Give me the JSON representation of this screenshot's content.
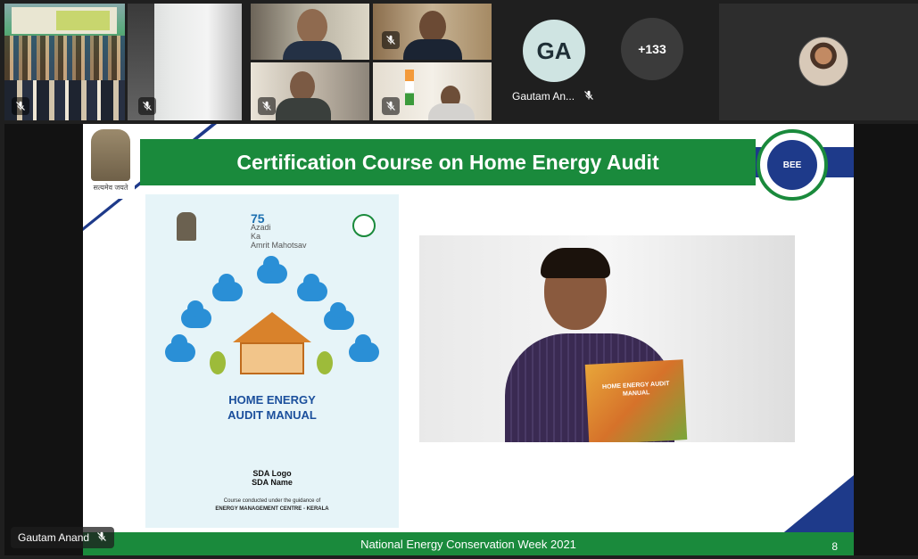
{
  "participants": {
    "named": {
      "initials": "GA",
      "name": "Gautam An..."
    },
    "overflow_count": "+133"
  },
  "slide": {
    "title": "Certification Course on Home Energy Audit",
    "emblem_motto": "सत्यमेव जयते",
    "footer": "National Energy Conservation Week 2021",
    "page": "8",
    "bee_logo_text": "BEE",
    "manual": {
      "azadi_75": "75",
      "azadi_line1": "Azadi",
      "azadi_line2": "Ka",
      "azadi_line3": "Amrit Mahotsav",
      "title_line1": "HOME ENERGY",
      "title_line2": "AUDIT MANUAL",
      "sda_logo": "SDA Logo",
      "sda_name": "SDA Name",
      "guidance": "Course conducted under the guidance of",
      "centre": "ENERGY MANAGEMENT CENTRE - KERALA"
    },
    "book_title": "HOME ENERGY AUDIT MANUAL"
  },
  "presenter": {
    "name": "Gautam Anand"
  },
  "icons": {
    "muted": "mic-off-icon"
  }
}
